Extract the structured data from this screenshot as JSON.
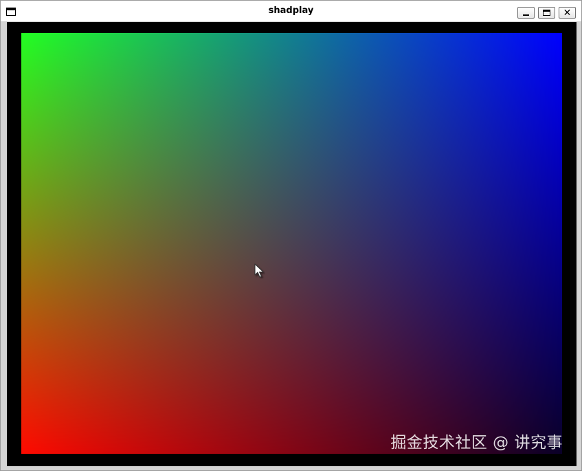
{
  "window": {
    "title": "shadplay"
  },
  "titlebar_buttons": {
    "minimize_icon": "minimize-icon",
    "maximize_icon": "maximize-icon",
    "close_icon": "close-icon"
  },
  "canvas": {
    "corner_colors": {
      "top_left": "#22ff22",
      "top_right": "#0000ff",
      "bottom_left": "#ff0a00",
      "bottom_right": "#0a0028",
      "center": "#85858a"
    }
  },
  "watermark": {
    "text": "掘金技术社区 @ 讲究事"
  },
  "cursor": {
    "icon": "arrow-cursor-icon"
  }
}
